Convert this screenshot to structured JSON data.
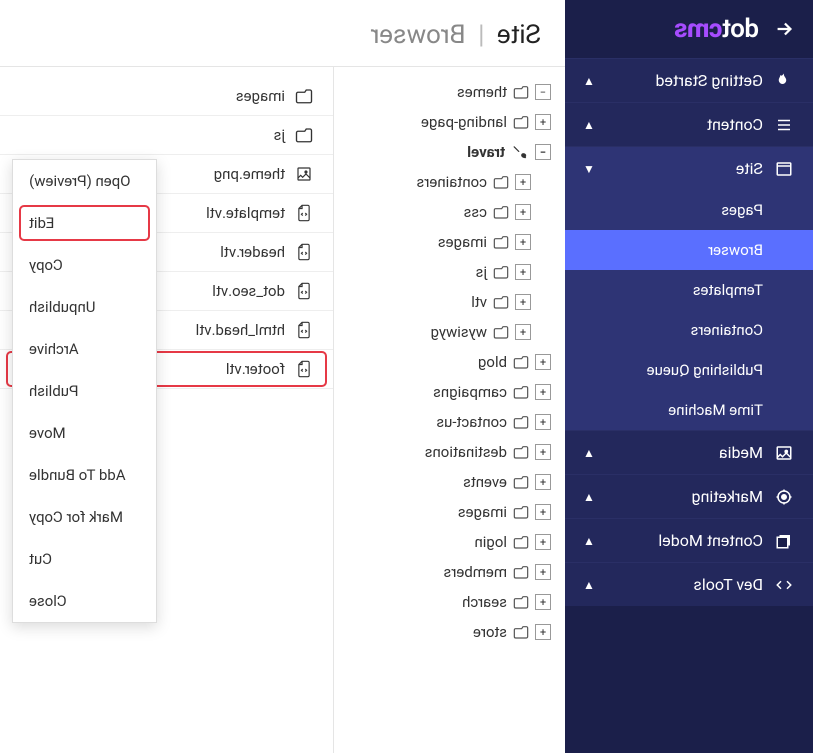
{
  "header": {
    "logo_dot": "dot",
    "logo_cms": "cms"
  },
  "nav": {
    "sections": [
      {
        "label": "Getting Started",
        "icon": "fire",
        "expanded": false
      },
      {
        "label": "Content",
        "icon": "list",
        "expanded": false
      },
      {
        "label": "Site",
        "icon": "window",
        "expanded": true,
        "items": [
          {
            "label": "Pages",
            "active": false
          },
          {
            "label": "Browser",
            "active": true
          },
          {
            "label": "Templates",
            "active": false
          },
          {
            "label": "Containers",
            "active": false
          },
          {
            "label": "Publishing Queue",
            "active": false
          },
          {
            "label": "Time Machine",
            "active": false
          }
        ]
      },
      {
        "label": "Media",
        "icon": "image",
        "expanded": false
      },
      {
        "label": "Marketing",
        "icon": "target",
        "expanded": false
      },
      {
        "label": "Content Model",
        "icon": "stack",
        "expanded": false
      },
      {
        "label": "Dev Tools",
        "icon": "code",
        "expanded": false
      }
    ]
  },
  "breadcrumb": {
    "main": "Site",
    "sub": "Browser"
  },
  "tree": {
    "items": [
      {
        "name": "themes",
        "toggle": "−",
        "level": 0
      },
      {
        "name": "landing-page",
        "toggle": "+",
        "level": 0
      },
      {
        "name": "travel",
        "toggle": "−",
        "level": 0,
        "selected": true,
        "icon": "brush"
      },
      {
        "name": "containers",
        "toggle": "+",
        "level": 1
      },
      {
        "name": "css",
        "toggle": "+",
        "level": 1
      },
      {
        "name": "images",
        "toggle": "+",
        "level": 1
      },
      {
        "name": "js",
        "toggle": "+",
        "level": 1
      },
      {
        "name": "vtl",
        "toggle": "+",
        "level": 1
      },
      {
        "name": "wysiwyg",
        "toggle": "+",
        "level": 1
      },
      {
        "name": "blog",
        "toggle": "+",
        "level": 0
      },
      {
        "name": "campaigns",
        "toggle": "+",
        "level": 0
      },
      {
        "name": "contact-us",
        "toggle": "+",
        "level": 0
      },
      {
        "name": "destinations",
        "toggle": "+",
        "level": 0
      },
      {
        "name": "events",
        "toggle": "+",
        "level": 0
      },
      {
        "name": "images",
        "toggle": "+",
        "level": 0
      },
      {
        "name": "login",
        "toggle": "+",
        "level": 0
      },
      {
        "name": "members",
        "toggle": "+",
        "level": 0
      },
      {
        "name": "search",
        "toggle": "+",
        "level": 0
      },
      {
        "name": "store",
        "toggle": "+",
        "level": 0
      }
    ]
  },
  "files": {
    "items": [
      {
        "name": "images",
        "type": "folder"
      },
      {
        "name": "js",
        "type": "folder"
      },
      {
        "name": "theme.png",
        "type": "image"
      },
      {
        "name": "template.vtl",
        "type": "code"
      },
      {
        "name": "header.vtl",
        "type": "code"
      },
      {
        "name": "dot_seo.vtl",
        "type": "code"
      },
      {
        "name": "html_head.vtl",
        "type": "code"
      },
      {
        "name": "footer.vtl",
        "type": "code",
        "highlighted": true
      }
    ]
  },
  "context_menu": {
    "items": [
      {
        "label": "Open (Preview)"
      },
      {
        "label": "Edit",
        "highlighted": true
      },
      {
        "label": "Copy"
      },
      {
        "label": "Unpublish"
      },
      {
        "label": "Archive"
      },
      {
        "label": "Publish"
      },
      {
        "label": "Move"
      },
      {
        "label": "Add To Bundle"
      },
      {
        "label": "Mark for Copy"
      },
      {
        "label": "Cut"
      },
      {
        "label": "Close"
      }
    ]
  }
}
